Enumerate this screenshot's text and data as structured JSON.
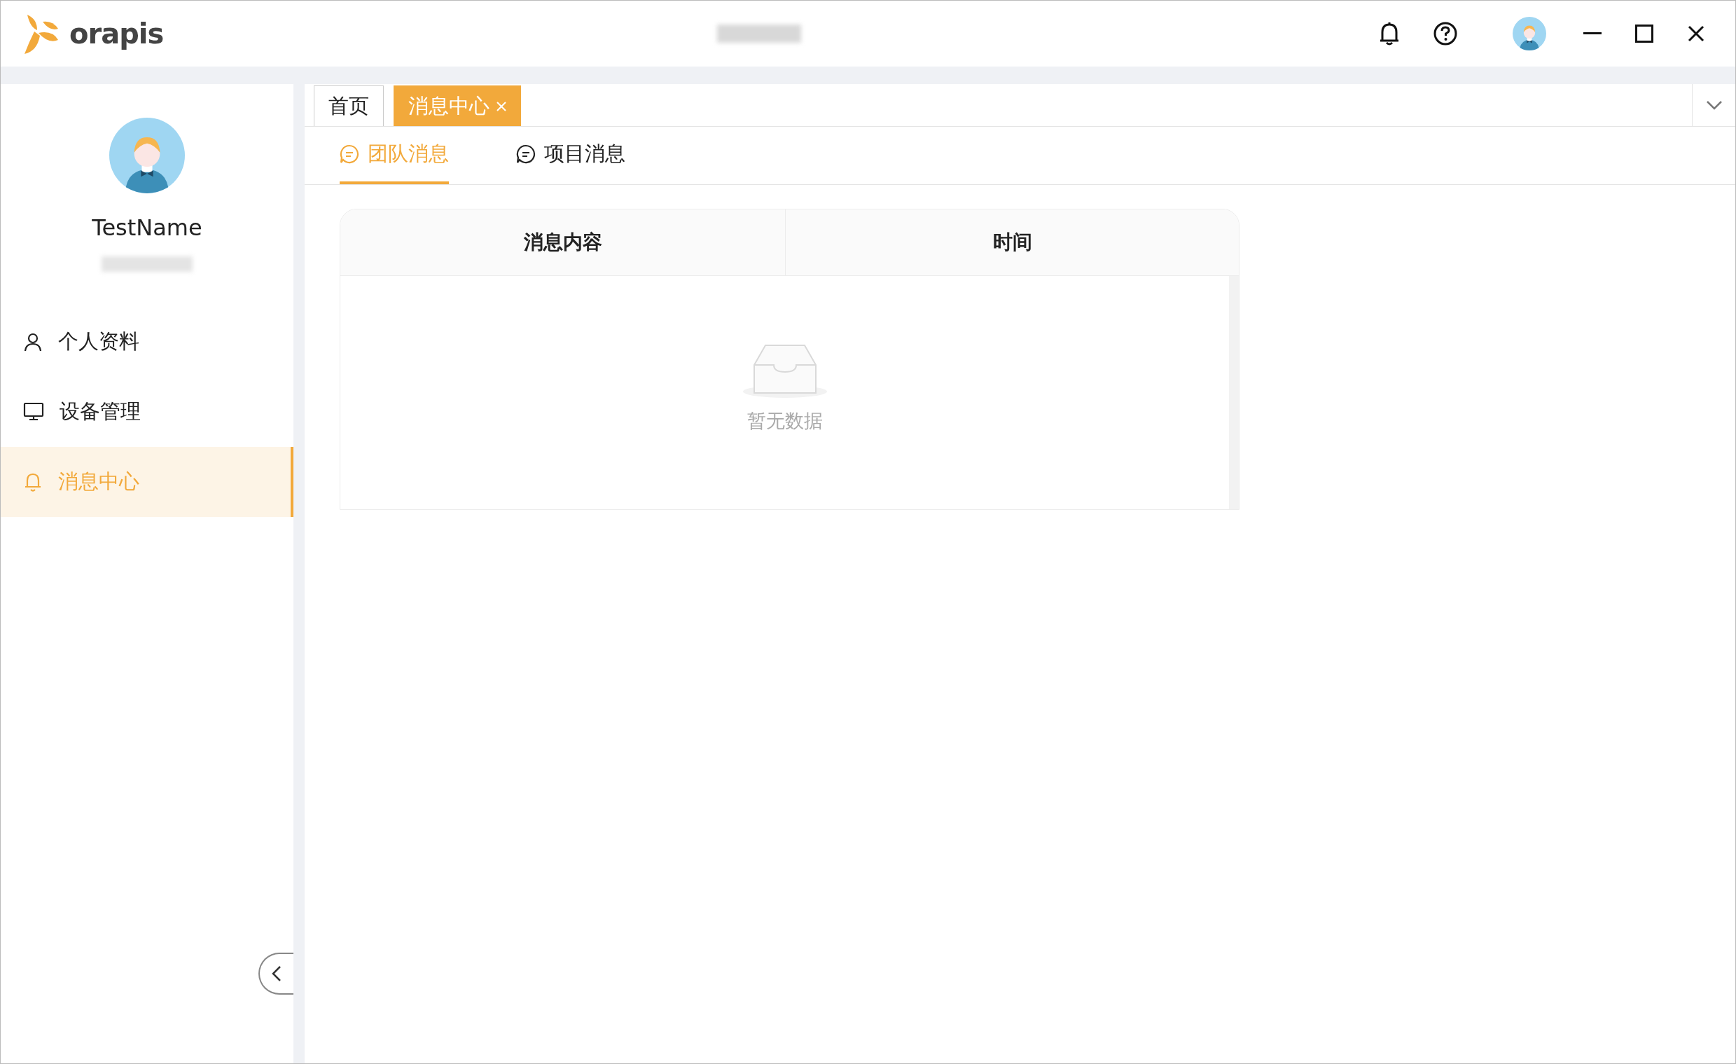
{
  "app": {
    "logo_text": "orapis"
  },
  "user": {
    "name": "TestName"
  },
  "menu": [
    {
      "label": "个人资料",
      "kind": "profile",
      "selected": false
    },
    {
      "label": "设备管理",
      "kind": "devices",
      "selected": false
    },
    {
      "label": "消息中心",
      "kind": "messages",
      "selected": true
    }
  ],
  "page_tabs": [
    {
      "label": "首页",
      "selected": false,
      "closable": false
    },
    {
      "label": "消息中心",
      "selected": true,
      "closable": true
    }
  ],
  "sub_tabs": [
    {
      "label": "团队消息",
      "selected": true
    },
    {
      "label": "项目消息",
      "selected": false
    }
  ],
  "table": {
    "columns": [
      "消息内容",
      "时间"
    ],
    "empty_text": "暂无数据"
  }
}
